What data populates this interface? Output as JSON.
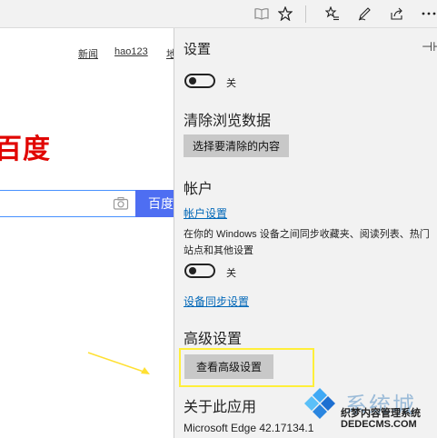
{
  "toolbar": {
    "icons": [
      "reading-view-icon",
      "favorite-star-icon",
      "favorites-hub-icon",
      "web-note-icon",
      "share-icon",
      "more-icon"
    ]
  },
  "page": {
    "nav_links": [
      "新闻",
      "hao123",
      "地"
    ],
    "logo": "百度",
    "search_button": "百度"
  },
  "settings": {
    "title": "设置",
    "toggle1_label": "关",
    "clear_heading": "清除浏览数据",
    "clear_button": "选择要清除的内容",
    "account_heading": "帐户",
    "account_link": "帐户设置",
    "sync_desc": "在你的 Windows 设备之间同步收藏夹、阅读列表、热门站点和其他设置",
    "toggle2_label": "关",
    "sync_link": "设备同步设置",
    "advanced_heading": "高级设置",
    "advanced_button": "查看高级设置",
    "about_heading": "关于此应用",
    "version_text": "Microsoft Edge 42.17134.1"
  },
  "watermark": {
    "brand": "系统城",
    "text": "织梦内容管理系统",
    "url": "DEDECMS.COM",
    "subtext": "xitongcheng.com"
  },
  "colors": {
    "link": "#0067b8",
    "highlight": "#ffef3a",
    "baidu_red": "#e10602",
    "baidu_blue": "#4e6ef2"
  }
}
